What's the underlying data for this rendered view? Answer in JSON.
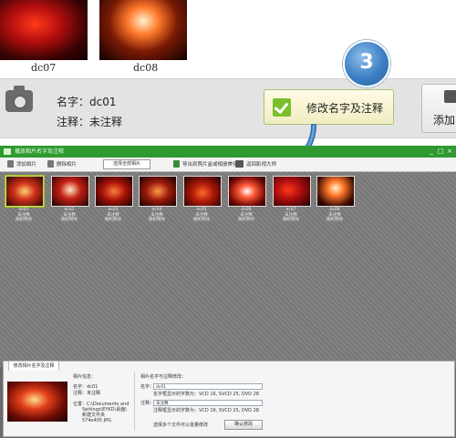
{
  "top_gallery": {
    "items": [
      {
        "caption": "dc07"
      },
      {
        "caption": "dc08"
      }
    ]
  },
  "info_bar": {
    "name_label": "名字：dc01",
    "note_label": "注释：未注释"
  },
  "step_badge": {
    "number": "3"
  },
  "edit_button": {
    "label": "修改名字及注释"
  },
  "add_button": {
    "label": "添加"
  },
  "window": {
    "title": "播放相片名字及注释",
    "controls": [
      "_",
      "□",
      "×"
    ],
    "toolbar": {
      "add_photo": "添加相片",
      "delete_photo": "删除相片",
      "select_all": "选择全部相片",
      "export": "导出到照片盒或相册美化",
      "return": "返回影视大师"
    },
    "thumbnails": [
      {
        "name": "dc01",
        "note": "未注释",
        "tag": "随机特效"
      },
      {
        "name": "dc02",
        "note": "未注释",
        "tag": "随机特效"
      },
      {
        "name": "dc03",
        "note": "未注释",
        "tag": "随机特效"
      },
      {
        "name": "dc04",
        "note": "未注释",
        "tag": "随机特效"
      },
      {
        "name": "dc05",
        "note": "未注释",
        "tag": "随机特效"
      },
      {
        "name": "dc06",
        "note": "未注释",
        "tag": "随机特效"
      },
      {
        "name": "dc07",
        "note": "未注释",
        "tag": "随机特效"
      },
      {
        "name": "dc08",
        "note": "未注释",
        "tag": "随机特效"
      }
    ],
    "panel": {
      "tab": "修改相片名字及注释",
      "info_heading": "相片信息：",
      "name_line": "名字：dc01",
      "note_line": "注释：未注释",
      "location_line1": "位置：C:\\Documents and",
      "location_line2": "Settings\\EYKD\\桌面\\",
      "location_line3": "新建文件夹",
      "size_line": "574x405  JPG",
      "edit_heading": "相片名字与注释修改：",
      "name_field_label": "名字：",
      "name_field_value": "dc01",
      "name_hint": "名字框显示的字数为：VCD 16, SVCD 25, DVD 28",
      "note_field_label": "注释：",
      "note_field_value": "未注释",
      "note_hint": "注释框显示的字数为：VCD 16, SVCD 25, DVD 28",
      "multi_hint": "选择多个文件可以批量修改",
      "confirm_button": "确认修改"
    }
  }
}
